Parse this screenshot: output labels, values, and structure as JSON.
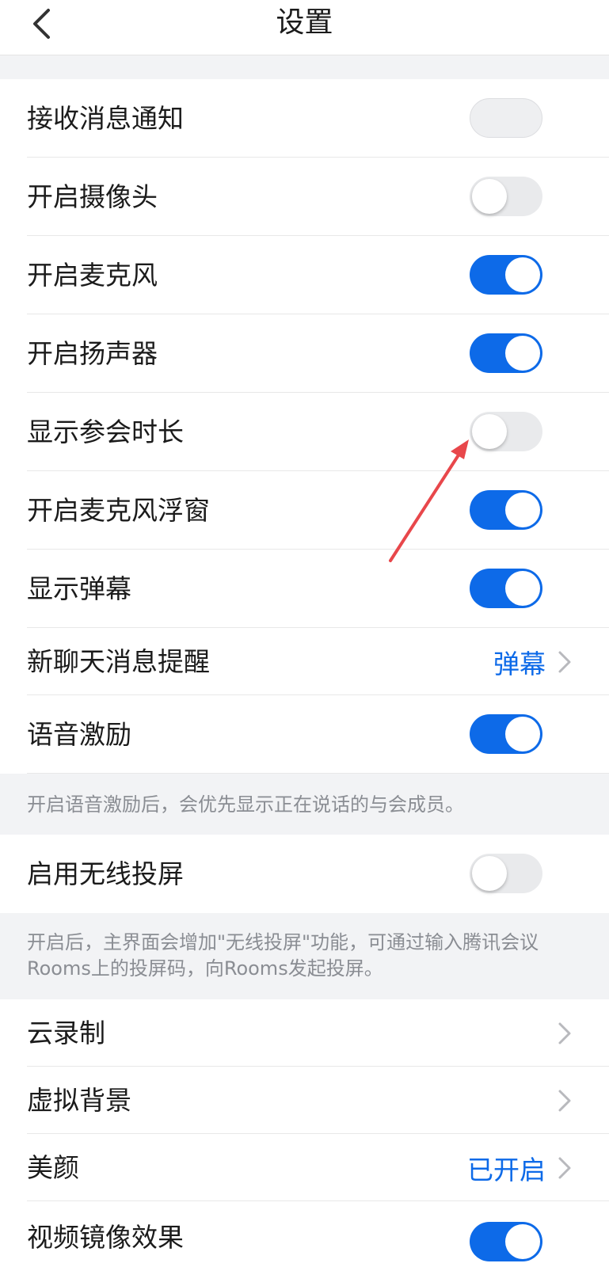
{
  "header": {
    "title": "设置",
    "back_icon": "chevron-left-icon"
  },
  "colors": {
    "accent": "#0d6ae8",
    "toggle_off": "#e9eaec",
    "note_text": "#8a8d93",
    "background": "#f2f3f5"
  },
  "rows": [
    {
      "label": "接收消息通知",
      "control": "toggle",
      "state": "off-disabled"
    },
    {
      "label": "开启摄像头",
      "control": "toggle",
      "state": "off"
    },
    {
      "label": "开启麦克风",
      "control": "toggle",
      "state": "on"
    },
    {
      "label": "开启扬声器",
      "control": "toggle",
      "state": "on"
    },
    {
      "label": "显示参会时长",
      "control": "toggle",
      "state": "off"
    },
    {
      "label": "开启麦克风浮窗",
      "control": "toggle",
      "state": "on"
    },
    {
      "label": "显示弹幕",
      "control": "toggle",
      "state": "on"
    },
    {
      "label": "新聊天消息提醒",
      "control": "value",
      "value": "弹幕"
    },
    {
      "label": "语音激励",
      "control": "toggle",
      "state": "on"
    }
  ],
  "note1": "开启语音激励后，会优先显示正在说话的与会成员。",
  "wireless": {
    "label": "启用无线投屏",
    "state": "off"
  },
  "note2_line1": "开启后，主界面会增加\"无线投屏\"功能，可通过输入腾讯会议",
  "note2_line2": "Rooms上的投屏码，向Rooms发起投屏。",
  "rows3": [
    {
      "label": "云录制",
      "control": "chevron"
    },
    {
      "label": "虚拟背景",
      "control": "chevron"
    },
    {
      "label": "美颜",
      "control": "value",
      "value": "已开启"
    },
    {
      "label": "视频镜像效果",
      "control": "toggle",
      "state": "on"
    }
  ]
}
